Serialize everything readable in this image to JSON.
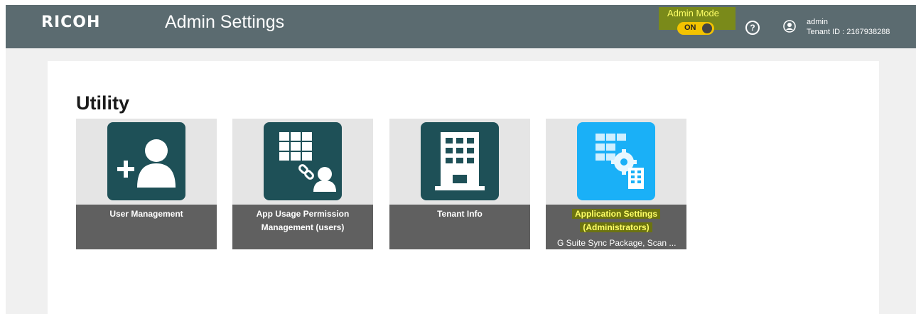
{
  "header": {
    "logo": "RICOH",
    "title": "Admin Settings",
    "admin_mode_label": "Admin Mode",
    "toggle_state": "ON",
    "help_icon": "?",
    "user_name": "admin",
    "tenant_id": "Tenant ID : 2167938288"
  },
  "colors": {
    "header_bg": "#5b6b70",
    "tile_icon_dark": "#1e5057",
    "tile_icon_light": "#1ab0f7",
    "tile_label_bg": "#606060",
    "highlight": "#cfd400"
  },
  "main": {
    "section_title": "Utility",
    "tiles": [
      {
        "icon": "add-user-icon",
        "label": "User Management",
        "sub": ""
      },
      {
        "icon": "app-permission-icon",
        "label_line1": "App Usage Permission",
        "label_line2": "Management (users)",
        "sub": ""
      },
      {
        "icon": "building-icon",
        "label": "Tenant Info",
        "sub": ""
      },
      {
        "icon": "app-settings-icon",
        "label_line1": "Application Settings",
        "label_line2": "(Administrators)",
        "sub": "G Suite Sync Package, Scan ..."
      }
    ]
  }
}
